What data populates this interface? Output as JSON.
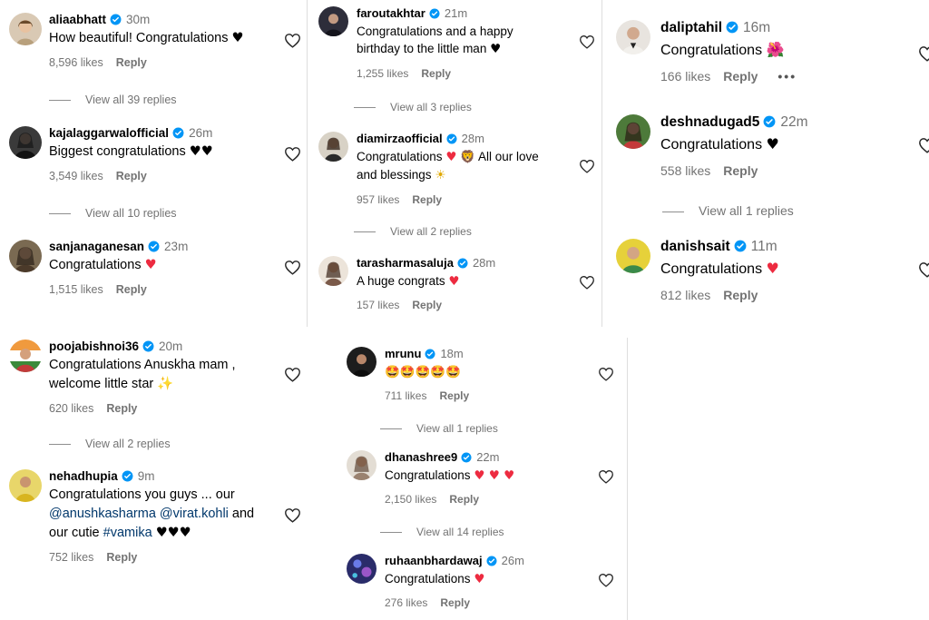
{
  "ui": {
    "reply_label": "Reply",
    "icons": {
      "like": "heart-outline-icon",
      "verified": "verified-badge-icon",
      "more": "more-options-icon"
    },
    "colors": {
      "verified": "#0095f6",
      "heart": "#ed2b40",
      "meta": "#737373"
    }
  },
  "columns": {
    "left": [
      {
        "username": "aliaabhatt",
        "time": "30m",
        "text": "How beautiful! Congratulations",
        "emoji": "♥",
        "likes": "8,596 likes",
        "view_replies": "View all 39 replies"
      },
      {
        "username": "kajalaggarwalofficial",
        "time": "26m",
        "text": "Biggest congratulations",
        "emoji": "♥♥",
        "likes": "3,549 likes",
        "view_replies": "View all 10 replies"
      },
      {
        "username": "sanjanaganesan",
        "time": "23m",
        "text": "Congratulations",
        "emoji": "♥",
        "likes": "1,515 likes"
      },
      {
        "username": "poojabishnoi36",
        "time": "20m",
        "text": "Congratulations Anuskha mam ,",
        "text2": "welcome little star",
        "emoji": "✨",
        "likes": "620 likes",
        "view_replies": "View all 2 replies"
      },
      {
        "username": "nehadhupia",
        "time": "9m",
        "text": "Congratulations you guys ... our",
        "mention1": "@anushkasharma",
        "mention2": "@virat.kohli",
        "text_and": "and",
        "text3": "our cutie",
        "hashtag": "#vamika",
        "emoji": "♥♥♥",
        "likes": "752 likes"
      }
    ],
    "middle": [
      {
        "username": "faroutakhtar",
        "time": "21m",
        "text": "Congratulations and a happy",
        "text2": "birthday to the little man",
        "emoji": "♥",
        "likes": "1,255 likes",
        "view_replies": "View all 3 replies"
      },
      {
        "username": "diamirzaofficial",
        "time": "28m",
        "text": "Congratulations",
        "emoji1": "♥",
        "emoji2": "🦁",
        "text_b": "All our love",
        "text2": "and blessings",
        "emoji3": "☀",
        "likes": "957 likes",
        "view_replies": "View all 2 replies"
      },
      {
        "username": "tarasharmasaluja",
        "time": "28m",
        "text": "A huge congrats",
        "emoji": "♥",
        "likes": "157 likes"
      },
      {
        "username": "mrunu",
        "time": "18m",
        "text": "",
        "emoji": "🤩🤩🤩🤩🤩",
        "likes": "711 likes",
        "view_replies": "View all 1 replies"
      },
      {
        "username": "dhanashree9",
        "time": "22m",
        "text": "Congratulations",
        "emoji": "♥ ♥ ♥",
        "likes": "2,150 likes",
        "view_replies": "View all 14 replies"
      },
      {
        "username": "ruhaanbhardawaj",
        "time": "26m",
        "text": "Congratulations",
        "emoji": "♥",
        "likes": "276 likes"
      }
    ],
    "right": [
      {
        "username": "daliptahil",
        "time": "16m",
        "text": "Congratulations",
        "emoji": "🌺",
        "likes": "166 likes",
        "more": "•••"
      },
      {
        "username": "deshnadugad5",
        "time": "22m",
        "text": "Congratulations",
        "emoji": "♥",
        "likes": "558 likes",
        "view_replies": "View all 1 replies"
      },
      {
        "username": "danishsait",
        "time": "11m",
        "text": "Congratulations",
        "emoji": "♥",
        "likes": "812 likes"
      }
    ]
  }
}
